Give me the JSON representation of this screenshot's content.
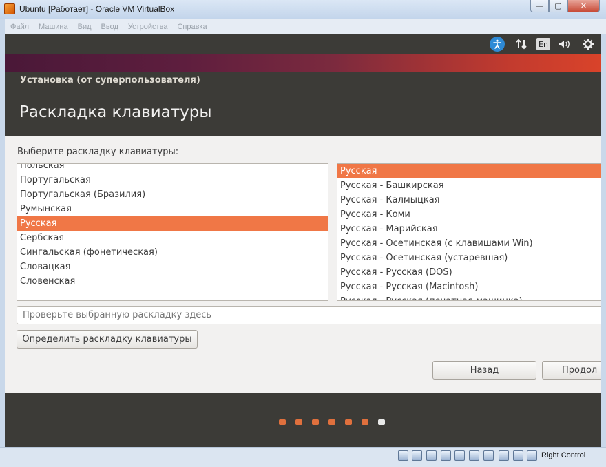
{
  "window": {
    "title": "Ubuntu [Работает] - Oracle VM VirtualBox",
    "controls": {
      "minimize": "—",
      "maximize": "▢",
      "close": "✕"
    }
  },
  "menubar": {
    "items": [
      "Файл",
      "Машина",
      "Вид",
      "Ввод",
      "Устройства",
      "Справка"
    ]
  },
  "guest": {
    "topbar": {
      "icons": [
        "accessibility-icon",
        "network-icon",
        "keyboard-layout-indicator",
        "volume-icon",
        "settings-gear-icon"
      ],
      "language": "En"
    },
    "installer": {
      "title": "Установка (от суперпользователя)",
      "page_title": "Раскладка клавиатуры",
      "prompt": "Выберите раскладку клавиатуры:",
      "layouts_left": [
        "Польская",
        "Португальская",
        "Португальская (Бразилия)",
        "Румынская",
        "Русская",
        "Сербская",
        "Сингальская (фонетическая)",
        "Словацкая",
        "Словенская"
      ],
      "layouts_left_selected": "Русская",
      "layouts_right": [
        "Русская",
        "Русская - Башкирская",
        "Русская - Калмыцкая",
        "Русская - Коми",
        "Русская - Марийская",
        "Русская - Осетинская (с клавишами Win)",
        "Русская - Осетинская (устаревшая)",
        "Русская - Русская (DOS)",
        "Русская - Русская (Macintosh)",
        "Русская - Русская (печатная машинка)"
      ],
      "layouts_right_selected": "Русская",
      "test_placeholder": "Проверьте выбранную раскладку здесь",
      "detect_button": "Определить раскладку клавиатуры",
      "back_button": "Назад",
      "next_button": "Продол",
      "progress": {
        "total_steps": 7,
        "current_step": 7
      }
    }
  },
  "statusbar": {
    "host_key": "Right Control"
  },
  "colors": {
    "accent": "#f07746",
    "header_bg": "#3c3b37",
    "panel_bg": "#f2f1f0"
  }
}
